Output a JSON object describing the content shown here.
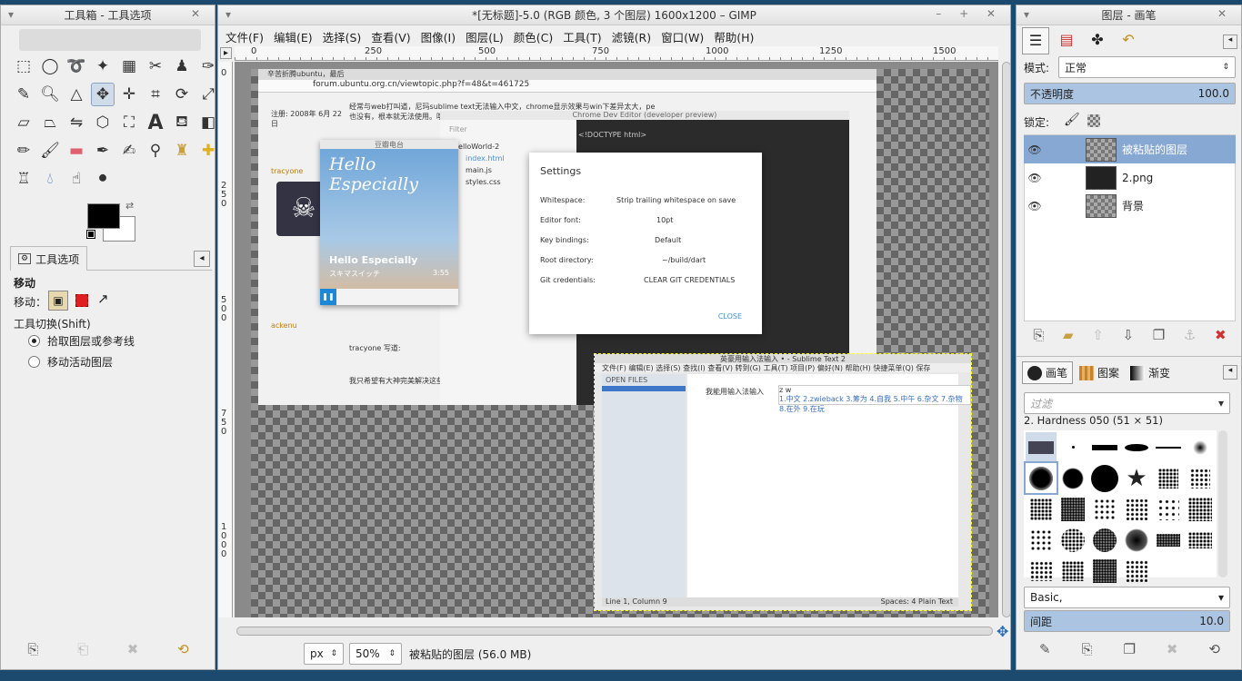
{
  "toolbox": {
    "title": "工具箱 - 工具选项",
    "tab_label": "工具选项",
    "options_title": "移动",
    "move_label": "移动：",
    "shortcut_label": "工具切换(Shift)",
    "radio_pick": "拾取图层或参考线",
    "radio_active": "移动活动图层",
    "tools": [
      "rect-select",
      "ellipse-select",
      "free-select",
      "fuzzy-select",
      "color-select",
      "scissors",
      "foreground-select",
      "paths",
      "color-picker",
      "zoom",
      "measure",
      "move",
      "align",
      "crop",
      "rotate",
      "scale",
      "shear",
      "perspective",
      "flip",
      "cage",
      "unified-transform",
      "text",
      "bucket-fill",
      "blend",
      "pencil",
      "paintbrush",
      "eraser",
      "airbrush",
      "ink",
      "mypaint",
      "clone",
      "heal",
      "perspective-clone",
      "blur",
      "smudge",
      "dodge-burn"
    ]
  },
  "main": {
    "title": "*[无标题]-5.0 (RGB 颜色, 3 个图层) 1600x1200 – GIMP",
    "menu": [
      "文件(F)",
      "编辑(E)",
      "选择(S)",
      "查看(V)",
      "图像(I)",
      "图层(L)",
      "颜色(C)",
      "工具(T)",
      "滤镜(R)",
      "窗口(W)",
      "帮助(H)"
    ],
    "ruler_h": [
      "0",
      "250",
      "500",
      "750",
      "1000",
      "1250",
      "1500"
    ],
    "ruler_v": [
      "0",
      "250",
      "500",
      "750",
      "1000"
    ],
    "unit": "px",
    "zoom": "50%",
    "status": "被粘贴的图层 (56.0 MB)"
  },
  "pasted": {
    "browser_tab": "辛苦折腾ubuntu，最后",
    "url": "forum.ubuntu.org.cn/viewtopic.php?f=48&t=461725",
    "post_text": "经常与web打叫道，尼玛sublime text无法输入中文，chrome显示效果与win下差异太大，pe也没有，根本就无法使用。哦。",
    "user1": "注册: 2008年 6月 22日",
    "user2": "tracyone",
    "user3": "ackenu",
    "quote": "tracyone 写道:",
    "reply": "我只希望有大神完美解决这些问题",
    "devtools_title": "Chrome Dev Editor (developer preview)",
    "filter": "Filter",
    "tree": [
      "HelloWorld-2",
      "index.html",
      "main.js",
      "styles.css"
    ],
    "file_tab": "index.html",
    "code": "<!DOCTYPE html>",
    "settings_title": "Settings",
    "settings_rows": [
      {
        "label": "Whitespace:",
        "value": "Strip trailing whitespace on save"
      },
      {
        "label": "Editor font:",
        "value": "10pt"
      },
      {
        "label": "Key bindings:",
        "value": "Default"
      },
      {
        "label": "Root directory:",
        "value": "~/build/dart"
      },
      {
        "label": "Git credentials:",
        "value": "CLEAR GIT CREDENTIALS"
      }
    ],
    "close": "CLOSE",
    "music_title": "豆瓣电台",
    "album": "Hello Especially",
    "artist": "スキマスイッチ",
    "time": "3:55",
    "sublime_title": "英豪用输入法输入 • - Sublime Text 2",
    "sublime_menu": "文件(F) 编辑(E) 选择(S) 查找(I) 查看(V) 转到(G) 工具(T) 项目(P) 偏好(N) 帮助(H) 快捷菜单(Q) 保存",
    "open_files": "OPEN FILES",
    "editor_line": "我能用输入法输入",
    "ime_input": "z w",
    "ime_candidates": "1.中文 2.zwieback 3.筹为 4.自我 5.中午 6.杂文 7.杂物 8.在外 9.在玩",
    "status_left": "Line 1, Column 9",
    "status_right": "Spaces: 4      Plain Text"
  },
  "layers": {
    "title": "图层 - 画笔",
    "mode_label": "模式:",
    "mode": "正常",
    "opacity_label": "不透明度",
    "opacity": "100.0",
    "lock_label": "锁定:",
    "rows": [
      {
        "name": "被粘贴的图层"
      },
      {
        "name": "2.png"
      },
      {
        "name": "背景"
      }
    ],
    "brush_tabs": [
      "画笔",
      "图案",
      "渐变"
    ],
    "filter_placeholder": "过滤",
    "brush_name": "2. Hardness 050 (51 × 51)",
    "preset": "Basic,",
    "spacing_label": "间距",
    "spacing": "10.0"
  },
  "colors": {
    "accent": "#86a8d2",
    "fg": "#000000",
    "bg": "#ffffff"
  }
}
